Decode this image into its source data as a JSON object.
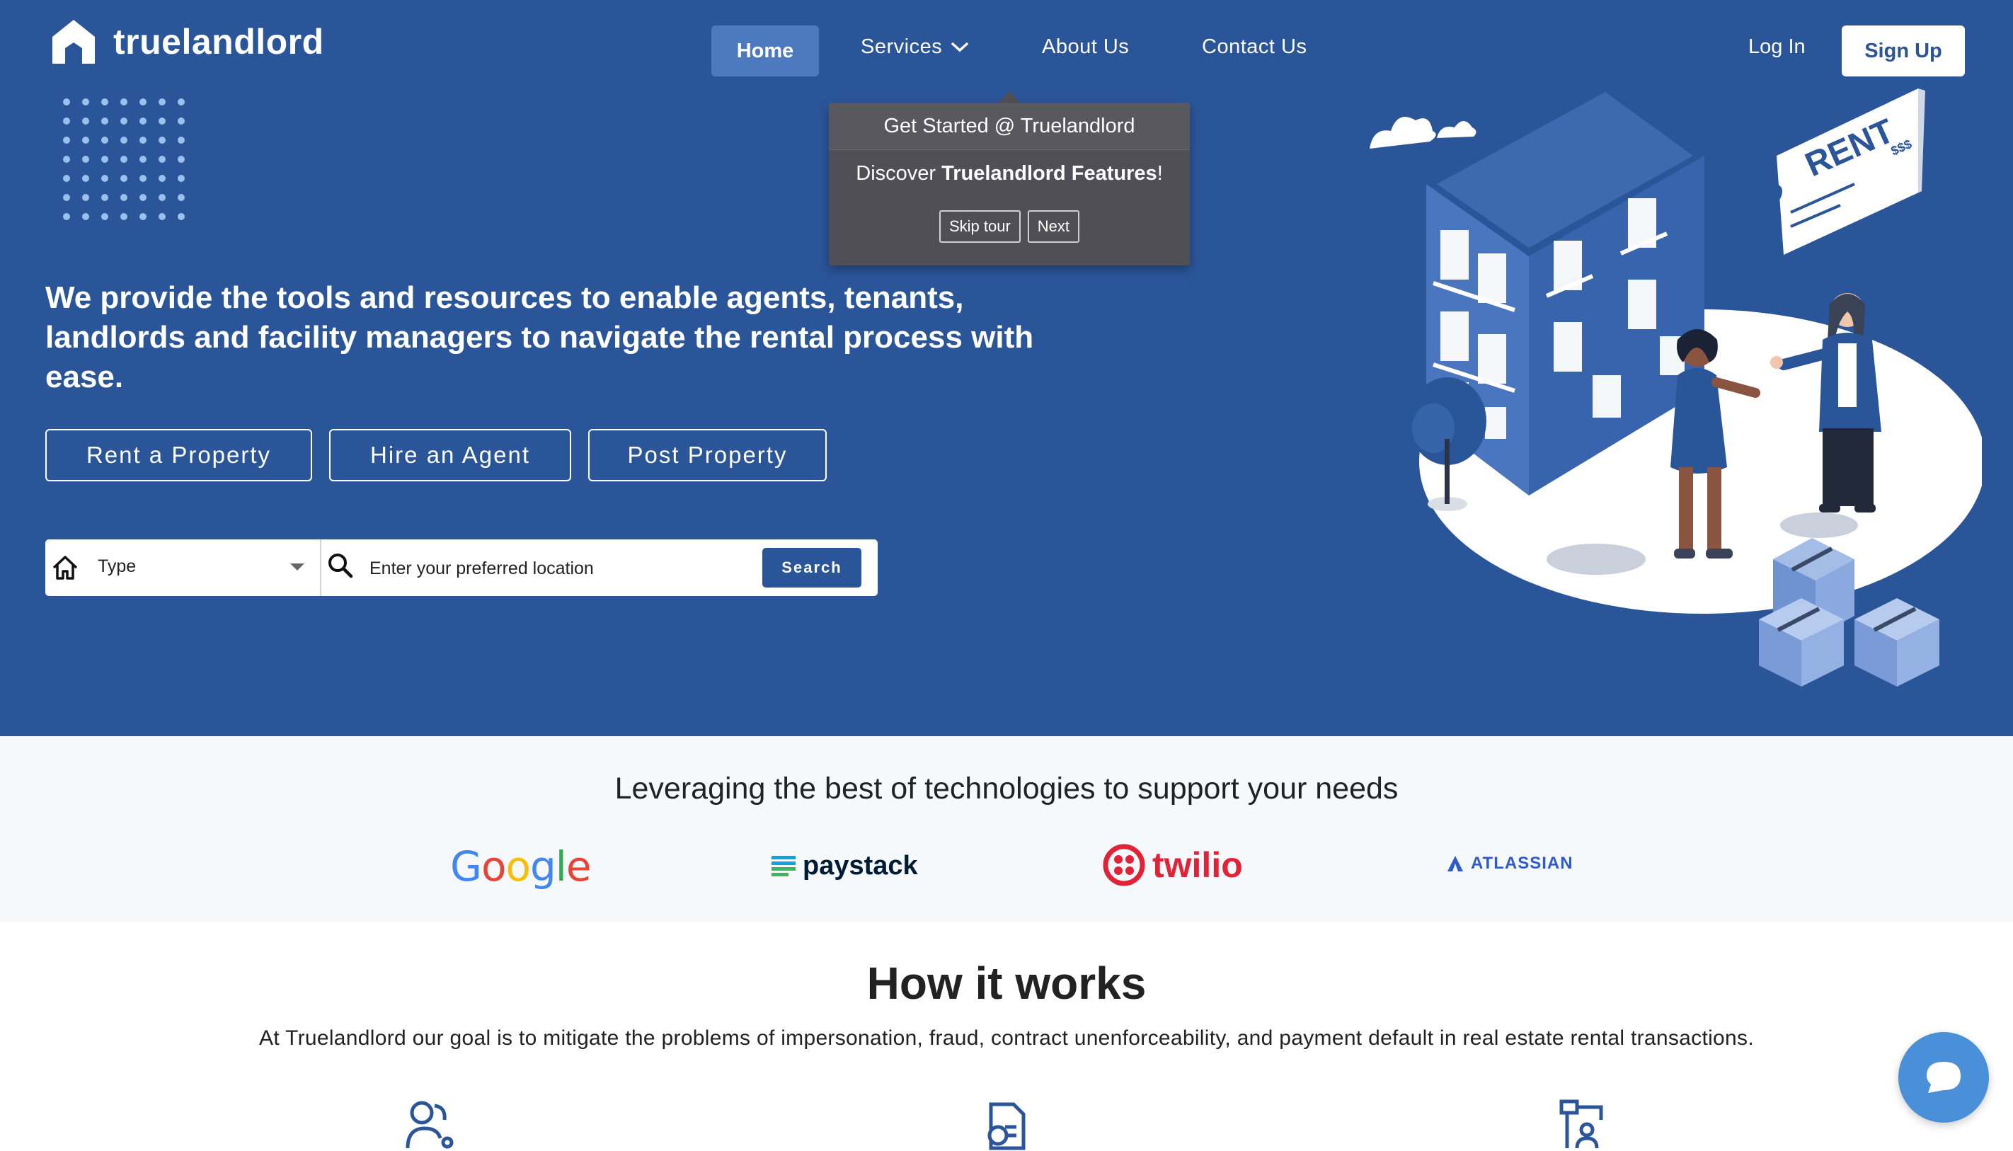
{
  "brand": {
    "name": "truelandlord"
  },
  "nav": {
    "home": "Home",
    "services": "Services",
    "about": "About Us",
    "contact": "Contact Us",
    "login": "Log In",
    "signup": "Sign Up"
  },
  "tour": {
    "title": "Get Started @ Truelandlord",
    "body_prefix": "Discover ",
    "body_bold": "Truelandlord Features",
    "body_suffix": "!",
    "skip": "Skip tour",
    "next": "Next"
  },
  "hero": {
    "headline": "We provide the tools and resources to enable agents, tenants, landlords and facility managers to navigate the rental process with ease.",
    "buttons": [
      "Rent a Property",
      "Hire an Agent",
      "Post Property"
    ],
    "illustration_text": "RENT",
    "illustration_price": "$$$"
  },
  "search": {
    "type_label": "Type",
    "location_placeholder": "Enter your preferred location",
    "button": "Search"
  },
  "tech": {
    "title": "Leveraging the best of technologies to support your needs",
    "brands": [
      "Google",
      "paystack",
      "twilio",
      "ATLASSIAN"
    ]
  },
  "how": {
    "title": "How it works",
    "subtitle": "At Truelandlord our goal is to mitigate the problems of impersonation, fraud, contract unenforceability, and payment default in real estate rental transactions."
  },
  "colors": {
    "primary": "#2a5599",
    "nav_active": "#4d7abf",
    "tech_bg": "#f5f9fc",
    "chat": "#4a90d9"
  },
  "icons": [
    "home-logo-icon",
    "chevron-down-icon",
    "house-icon",
    "search-icon",
    "chat-icon",
    "users-icon",
    "document-search-icon",
    "workflow-icon"
  ]
}
